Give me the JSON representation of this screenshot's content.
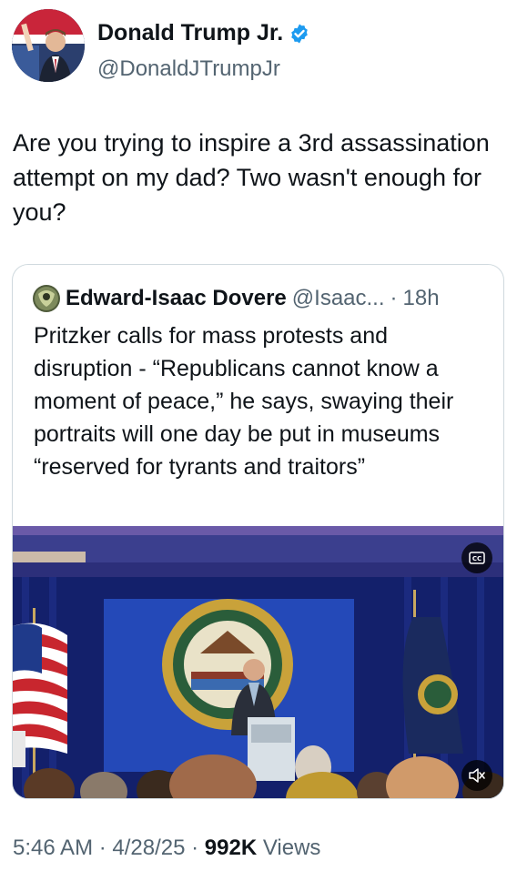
{
  "author": {
    "display_name": "Donald Trump Jr.",
    "handle": "@DonaldJTrumpJr",
    "verified_icon": "verified-badge-icon"
  },
  "tweet": {
    "text": "Are you trying to inspire a 3rd assassination attempt on my dad? Two wasn't enough for you?"
  },
  "quoted_tweet": {
    "display_name": "Edward-Isaac Dovere",
    "handle": "@Isaac...",
    "separator": "·",
    "time": "18h",
    "text": "Pritzker calls for mass protests and disruption - “Republicans cannot know a moment of peace,” he says, swaying their portraits will one day be put in museums “reserved for tyrants and traitors”",
    "media": {
      "cc_icon": "closed-captions-icon",
      "mute_icon": "muted-speaker-icon",
      "cc_label": "CC"
    }
  },
  "meta": {
    "time": "5:46 AM",
    "dot1": " · ",
    "date": "4/28/25",
    "dot2": " · ",
    "views_count": "992K",
    "views_label": " Views"
  },
  "colors": {
    "text_primary": "#0f1419",
    "text_secondary": "#536471",
    "verified_blue": "#1d9bf0",
    "border": "#cfd9de"
  }
}
